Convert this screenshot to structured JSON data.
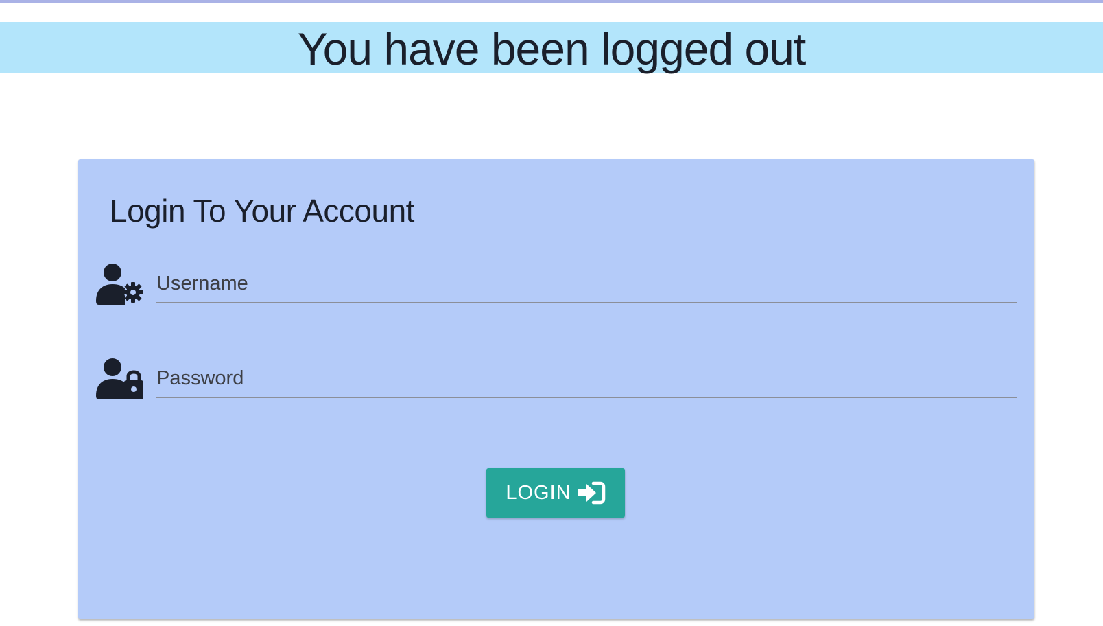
{
  "banner": {
    "message": "You have been logged out"
  },
  "login_card": {
    "title": "Login To Your Account",
    "username": {
      "placeholder": "Username",
      "value": "",
      "icon": "user-gear-icon"
    },
    "password": {
      "placeholder": "Password",
      "value": "",
      "icon": "user-lock-icon"
    },
    "submit": {
      "label": "LOGIN",
      "icon": "sign-in-icon"
    }
  },
  "colors": {
    "top_strip": "#aab2e6",
    "banner_background": "#b3e5fb",
    "card_background": "#b4cbf9",
    "button_background": "#26a69a",
    "text": "#1a1f2b"
  }
}
